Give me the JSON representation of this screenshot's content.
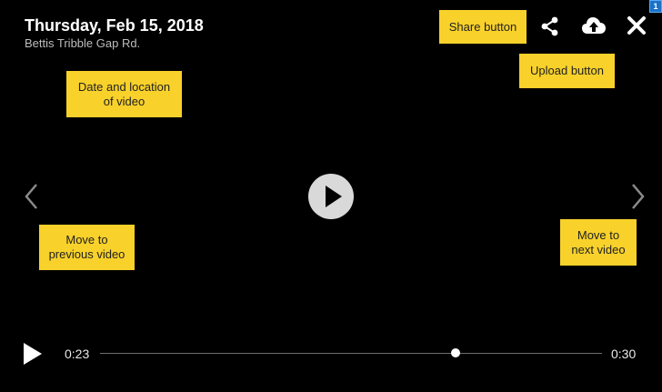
{
  "header": {
    "date": "Thursday, Feb 15, 2018",
    "location": "Bettis Tribble Gap Rd."
  },
  "badge": {
    "count": "1"
  },
  "annotations": {
    "share": "Share button",
    "upload": "Upload button",
    "date_location": "Date and location of video",
    "previous": "Move to previous video",
    "next": "Move to next video"
  },
  "player": {
    "current_time": "0:23",
    "duration": "0:30",
    "progress": 0.7083
  },
  "icons": {
    "share": "share-icon",
    "upload": "cloud-upload-icon",
    "close": "close-icon",
    "prev": "chevron-left-icon",
    "next": "chevron-right-icon",
    "center_play": "play-circle-icon",
    "bottom_play": "play-icon"
  },
  "colors": {
    "background": "#000000",
    "annotation": "#f8d12a",
    "badge": "#1a73c9"
  }
}
